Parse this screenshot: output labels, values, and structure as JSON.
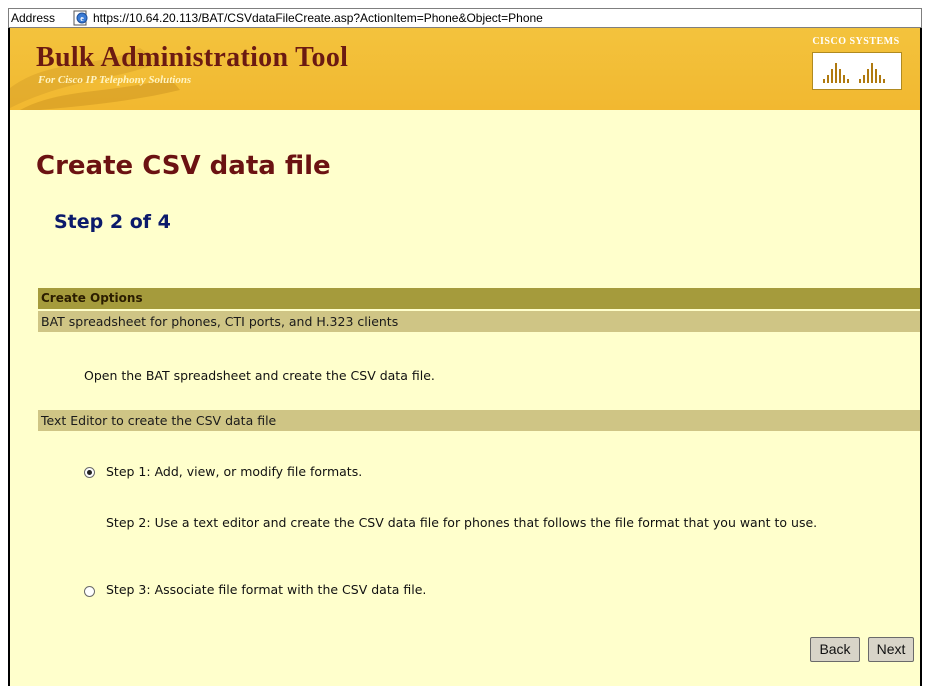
{
  "browser": {
    "address_label": "Address",
    "url": "https://10.64.20.113/BAT/CSVdataFileCreate.asp?ActionItem=Phone&Object=Phone"
  },
  "banner": {
    "title": "Bulk Administration Tool",
    "subtitle": "For Cisco IP Telephony Solutions",
    "logo_text": "CISCO SYSTEMS",
    "background_color": "#f2b830",
    "title_color": "#6b1a12"
  },
  "main": {
    "title": "Create CSV data file",
    "step": "Step 2 of 4",
    "options": {
      "header": "Create Options",
      "sections": [
        {
          "heading": "BAT spreadsheet for phones, CTI ports, and H.323 clients",
          "text": "Open the BAT spreadsheet and create the CSV data file."
        },
        {
          "heading": "Text Editor to create the CSV data file",
          "step1": "Step 1: Add, view, or modify file formats.",
          "step2": "Step 2: Use a text editor and create the CSV data file for phones that follows the file format that you want to use.",
          "step3": "Step 3: Associate file format with the CSV data file."
        }
      ]
    },
    "radio_selected": "step1"
  },
  "buttons": {
    "back": "Back",
    "next": "Next"
  }
}
